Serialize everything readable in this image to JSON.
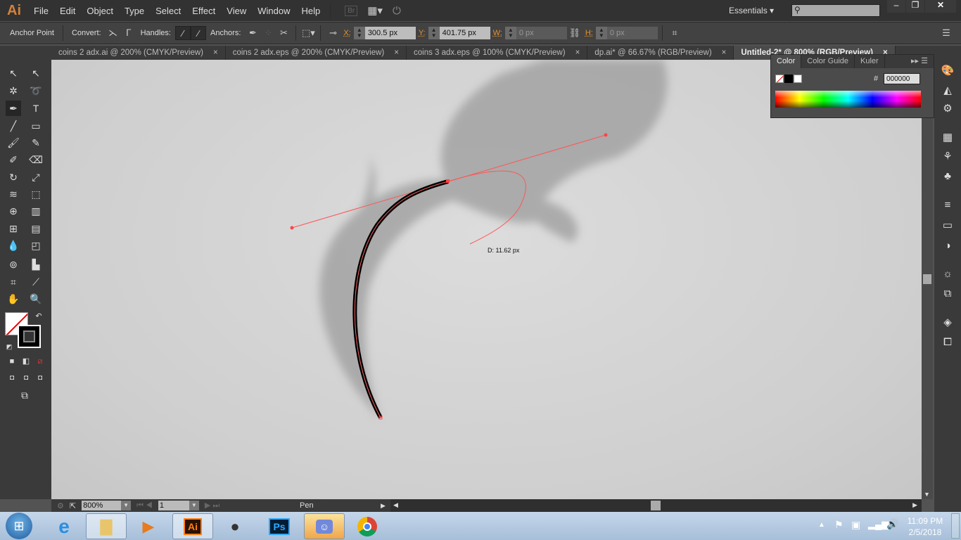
{
  "app": {
    "logo": "Ai",
    "menus": [
      "File",
      "Edit",
      "Object",
      "Type",
      "Select",
      "Effect",
      "View",
      "Window",
      "Help"
    ],
    "bridge": "Br",
    "workspace": "Essentials",
    "search_placeholder": ""
  },
  "control": {
    "tool_label": "Anchor Point",
    "convert": "Convert:",
    "handles": "Handles:",
    "anchors": "Anchors:",
    "x_label": "X:",
    "x_value": "300.5 px",
    "y_label": "Y:",
    "y_value": "401.75 px",
    "w_label": "W:",
    "w_value": "0 px",
    "h_label": "H:",
    "h_value": "0 px"
  },
  "tabs": [
    {
      "label": "coins 2 adx.ai @ 200% (CMYK/Preview)"
    },
    {
      "label": "coins 2 adx.eps @ 200% (CMYK/Preview)"
    },
    {
      "label": "coins 3 adx.eps @ 100% (CMYK/Preview)"
    },
    {
      "label": "dp.ai* @ 66.67% (RGB/Preview)"
    },
    {
      "label": "Untitled-2* @ 800% (RGB/Preview)",
      "active": true
    }
  ],
  "close_glyph": "×",
  "color_panel": {
    "tabs": [
      "Color",
      "Color Guide",
      "Kuler"
    ],
    "hash": "#",
    "hex": "000000"
  },
  "canvas": {
    "measure_label": "D: 11.62 px"
  },
  "status": {
    "zoom": "800%",
    "artboard": "1",
    "tool": "Pen"
  },
  "taskbar": {
    "time": "11:09 PM",
    "date": "2/5/2018",
    "apps": [
      "Internet Explorer",
      "Windows Explorer",
      "Media Player",
      "Illustrator",
      "Game",
      "Photoshop",
      "Discord",
      "Chrome"
    ]
  }
}
